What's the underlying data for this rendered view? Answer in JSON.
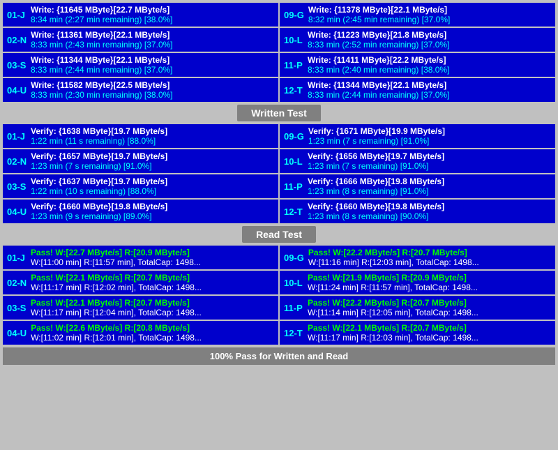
{
  "sections": {
    "write_test": {
      "label": "Written Test",
      "devices_left": [
        {
          "id": "01-J",
          "line1": "Write: {11645 MByte}[22.7 MByte/s]",
          "line2": "8:34 min (2:27 min remaining)  [38.0%]"
        },
        {
          "id": "02-N",
          "line1": "Write: {11361 MByte}[22.1 MByte/s]",
          "line2": "8:33 min (2:43 min remaining)  [37.0%]"
        },
        {
          "id": "03-S",
          "line1": "Write: {11344 MByte}[22.1 MByte/s]",
          "line2": "8:33 min (2:44 min remaining)  [37.0%]"
        },
        {
          "id": "04-U",
          "line1": "Write: {11582 MByte}[22.5 MByte/s]",
          "line2": "8:33 min (2:30 min remaining)  [38.0%]"
        }
      ],
      "devices_right": [
        {
          "id": "09-G",
          "line1": "Write: {11378 MByte}[22.1 MByte/s]",
          "line2": "8:32 min (2:45 min remaining)  [37.0%]"
        },
        {
          "id": "10-L",
          "line1": "Write: {11223 MByte}[21.8 MByte/s]",
          "line2": "8:33 min (2:52 min remaining)  [37.0%]"
        },
        {
          "id": "11-P",
          "line1": "Write: {11411 MByte}[22.2 MByte/s]",
          "line2": "8:33 min (2:40 min remaining)  [38.0%]"
        },
        {
          "id": "12-T",
          "line1": "Write: {11344 MByte}[22.1 MByte/s]",
          "line2": "8:33 min (2:44 min remaining)  [37.0%]"
        }
      ]
    },
    "verify_test": {
      "label": "Written Test",
      "devices_left": [
        {
          "id": "01-J",
          "line1": "Verify: {1638 MByte}[19.7 MByte/s]",
          "line2": "1:22 min (11 s remaining)   [88.0%]"
        },
        {
          "id": "02-N",
          "line1": "Verify: {1657 MByte}[19.7 MByte/s]",
          "line2": "1:23 min (7 s remaining)   [91.0%]"
        },
        {
          "id": "03-S",
          "line1": "Verify: {1637 MByte}[19.7 MByte/s]",
          "line2": "1:22 min (10 s remaining)   [88.0%]"
        },
        {
          "id": "04-U",
          "line1": "Verify: {1660 MByte}[19.8 MByte/s]",
          "line2": "1:23 min (9 s remaining)   [89.0%]"
        }
      ],
      "devices_right": [
        {
          "id": "09-G",
          "line1": "Verify: {1671 MByte}[19.9 MByte/s]",
          "line2": "1:23 min (7 s remaining)   [91.0%]"
        },
        {
          "id": "10-L",
          "line1": "Verify: {1656 MByte}[19.7 MByte/s]",
          "line2": "1:23 min (7 s remaining)   [91.0%]"
        },
        {
          "id": "11-P",
          "line1": "Verify: {1666 MByte}[19.8 MByte/s]",
          "line2": "1:23 min (8 s remaining)   [91.0%]"
        },
        {
          "id": "12-T",
          "line1": "Verify: {1660 MByte}[19.8 MByte/s]",
          "line2": "1:23 min (8 s remaining)   [90.0%]"
        }
      ]
    },
    "read_test": {
      "label": "Read Test",
      "devices_left": [
        {
          "id": "01-J",
          "line1": "Pass! W:[22.7 MByte/s] R:[20.9 MByte/s]",
          "line2": "W:[11:00 min] R:[11:57 min], TotalCap: 1498..."
        },
        {
          "id": "02-N",
          "line1": "Pass! W:[22.1 MByte/s] R:[20.7 MByte/s]",
          "line2": "W:[11:17 min] R:[12:02 min], TotalCap: 1498..."
        },
        {
          "id": "03-S",
          "line1": "Pass! W:[22.1 MByte/s] R:[20.7 MByte/s]",
          "line2": "W:[11:17 min] R:[12:04 min], TotalCap: 1498..."
        },
        {
          "id": "04-U",
          "line1": "Pass! W:[22.6 MByte/s] R:[20.8 MByte/s]",
          "line2": "W:[11:02 min] R:[12:01 min], TotalCap: 1498..."
        }
      ],
      "devices_right": [
        {
          "id": "09-G",
          "line1": "Pass! W:[22.2 MByte/s] R:[20.7 MByte/s]",
          "line2": "W:[11:16 min] R:[12:03 min], TotalCap: 1498..."
        },
        {
          "id": "10-L",
          "line1": "Pass! W:[21.9 MByte/s] R:[20.9 MByte/s]",
          "line2": "W:[11:24 min] R:[11:57 min], TotalCap: 1498..."
        },
        {
          "id": "11-P",
          "line1": "Pass! W:[22.2 MByte/s] R:[20.7 MByte/s]",
          "line2": "W:[11:14 min] R:[12:05 min], TotalCap: 1498..."
        },
        {
          "id": "12-T",
          "line1": "Pass! W:[22.1 MByte/s] R:[20.7 MByte/s]",
          "line2": "W:[11:17 min] R:[12:03 min], TotalCap: 1498..."
        }
      ]
    }
  },
  "footer": "100% Pass for Written and Read"
}
